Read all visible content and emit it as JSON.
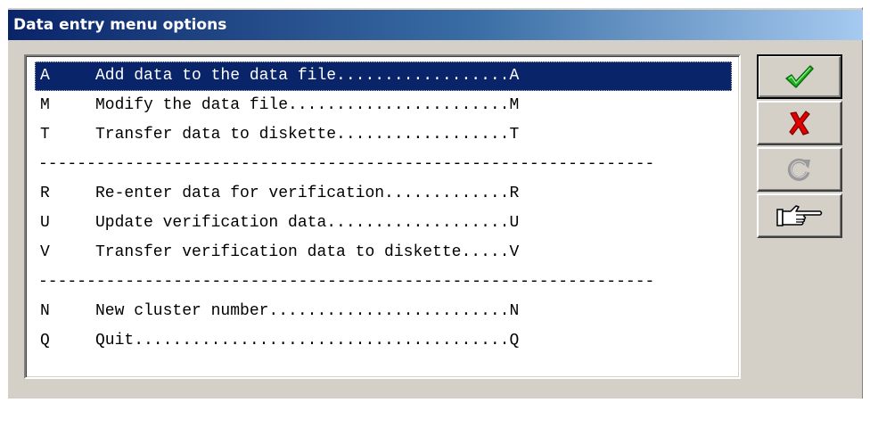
{
  "window": {
    "title": "Data entry menu options"
  },
  "menu": {
    "items": [
      {
        "key": "A",
        "label": "Add data to the data file..................A",
        "selected": true
      },
      {
        "key": "M",
        "label": "Modify the data file.......................M"
      },
      {
        "key": "T",
        "label": "Transfer data to diskette..................T"
      },
      {
        "separator": "----------------------------------------------------------------"
      },
      {
        "key": "R",
        "label": "Re-enter data for verification.............R"
      },
      {
        "key": "U",
        "label": "Update verification data...................U"
      },
      {
        "key": "V",
        "label": "Transfer verification data to diskette.....V"
      },
      {
        "separator": "----------------------------------------------------------------"
      },
      {
        "key": "N",
        "label": "New cluster number.........................N"
      },
      {
        "key": "Q",
        "label": "Quit.......................................Q"
      }
    ]
  },
  "buttons": [
    {
      "name": "ok",
      "icon": "checkmark-icon",
      "color": "#1aa31a"
    },
    {
      "name": "cancel",
      "icon": "cross-icon",
      "color": "#d40000"
    },
    {
      "name": "redo",
      "icon": "circular-arrow-icon",
      "color": "#a0a0a0"
    },
    {
      "name": "help",
      "icon": "pointing-hand-icon",
      "color": "#000000"
    }
  ]
}
